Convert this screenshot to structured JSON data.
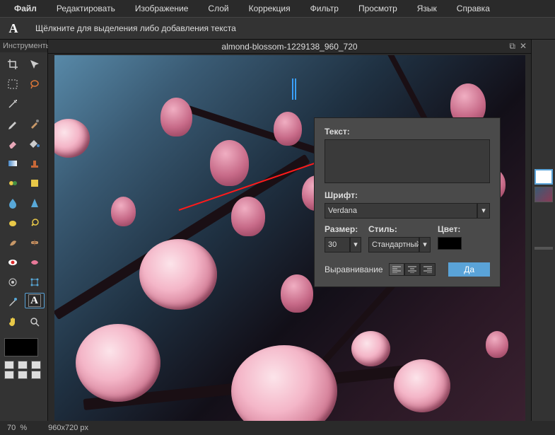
{
  "menu": [
    "Файл",
    "Редактировать",
    "Изображение",
    "Слой",
    "Коррекция",
    "Фильтр",
    "Просмотр",
    "Язык",
    "Справка"
  ],
  "activeToolGlyph": "A",
  "hint": "Щёлкните для выделения либо добавления текста",
  "toolsTitle": "Инструменты",
  "tabTitle": "almond-blossom-1229138_960_720",
  "dialog": {
    "textLabel": "Текст:",
    "fontLabel": "Шрифт:",
    "fontValue": "Verdana",
    "sizeLabel": "Размер:",
    "sizeValue": "30",
    "styleLabel": "Стиль:",
    "styleValue": "Стандартный",
    "colorLabel": "Цвет:",
    "alignLabel": "Выравнивание",
    "okLabel": "Да"
  },
  "status": {
    "zoom": "70",
    "zoomUnit": "%",
    "dims": "960x720 px"
  }
}
